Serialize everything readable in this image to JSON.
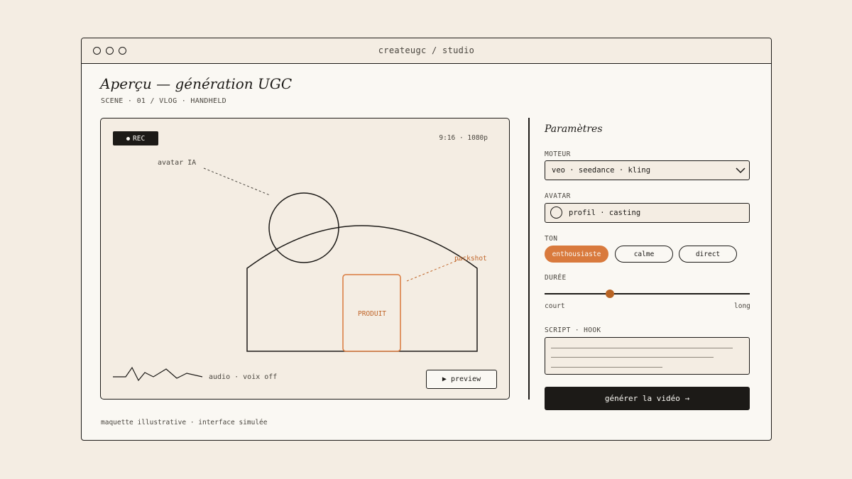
{
  "window": {
    "title": "createugc / studio"
  },
  "page": {
    "title": "Aperçu — génération UGC",
    "scene": "SCENE · 01 / VLOG · HANDHELD",
    "footnote": "maquette illustrative · interface simulée"
  },
  "preview": {
    "rec_label": "REC",
    "format": "9:16 · 1080p",
    "avatar_label": "avatar IA",
    "packshot_label": "packshot",
    "product_label": "PRODUIT",
    "audio_label": "audio · voix off",
    "preview_button": "▶ preview"
  },
  "params": {
    "title": "Paramètres",
    "engine": {
      "label": "MOTEUR",
      "value": "veo · seedance · kling"
    },
    "avatar": {
      "label": "AVATAR",
      "value": "profil · casting"
    },
    "tone": {
      "label": "TON",
      "options": [
        "enthousiaste",
        "calme",
        "direct"
      ],
      "selected": "enthousiaste"
    },
    "duration": {
      "label": "DURÉE",
      "min_label": "court",
      "max_label": "long",
      "value_fraction": 0.32
    },
    "script": {
      "label": "SCRIPT · HOOK"
    },
    "generate_button": "générer la vidéo →"
  },
  "colors": {
    "ink": "#1c1a17",
    "paper": "#faf8f3",
    "cream": "#f4ede3",
    "accent": "#d97a3d",
    "accent_dark": "#b86424"
  },
  "icons": [
    "window-dot-icon",
    "rec-dot-icon",
    "chevron-down-icon",
    "avatar-circle-icon",
    "audio-waveform-icon",
    "play-icon"
  ]
}
